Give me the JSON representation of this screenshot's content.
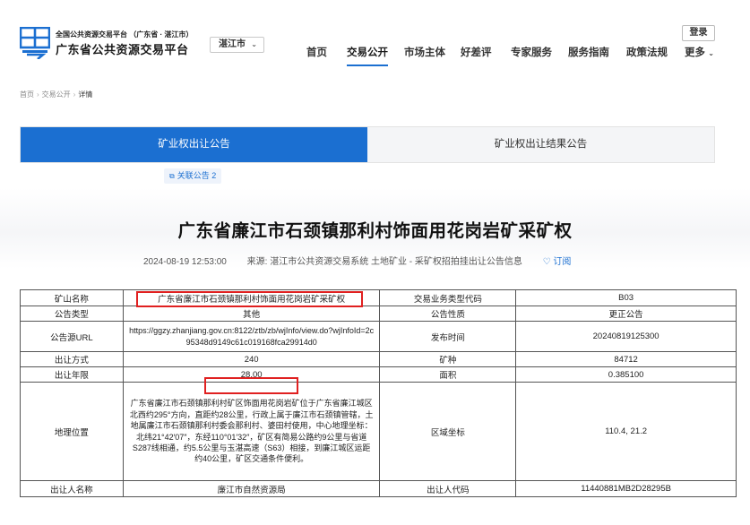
{
  "header": {
    "logo_subtitle": "全国公共资源交易平台 （广东省 · 湛江市）",
    "logo_title": "广东省公共资源交易平台",
    "city_select": "湛江市",
    "login_label": "登录",
    "nav": [
      "首页",
      "交易公开",
      "市场主体",
      "好差评",
      "专家服务",
      "服务指南",
      "政策法规",
      "更多"
    ],
    "nav_active": "交易公开"
  },
  "breadcrumb": [
    "首页",
    "交易公开",
    "详情"
  ],
  "tabs": {
    "active": "矿业权出让公告",
    "inactive": "矿业权出让结果公告"
  },
  "related_label": "关联公告 2",
  "announcement": {
    "title": "广东省廉江市石颈镇那利村饰面用花岗岩矿采矿权",
    "date": "2024-08-19 12:53:00",
    "source_label": "来源:",
    "source": "湛江市公共资源交易系统 土地矿业 - 采矿权招拍挂出让公告信息",
    "subscribe": "订阅"
  },
  "table": {
    "rows": [
      {
        "k1": "矿山名称",
        "v1": "广东省廉江市石颈镇那利村饰面用花岗岩矿采矿权",
        "k2": "交易业务类型代码",
        "v2": "B03"
      },
      {
        "k1": "公告类型",
        "v1": "其他",
        "k2": "公告性质",
        "v2": "更正公告"
      },
      {
        "k1": "公告源URL",
        "v1": "https://ggzy.zhanjiang.gov.cn:8122/ztb/zb/wjInfo/view.do?wjInfoId=2c95348d9149c61c019168fca29914d0",
        "k2": "发布时间",
        "v2": "20240819125300"
      },
      {
        "k1": "出让方式",
        "v1": "240",
        "k2": "矿种",
        "v2": "84712"
      },
      {
        "k1": "出让年限",
        "v1": "28.00",
        "k2": "面积",
        "v2": "0.385100"
      },
      {
        "k1": "地理位置",
        "v1": "广东省廉江市石颈镇那利村矿区饰面用花岗岩矿位于广东省廉江城区北西约295°方向，直距约28公里，行政上属于廉江市石颈镇管辖，土地属廉江市石颈镇那利村委会那利村、婆田村使用，中心地理坐标：北纬21°42′07″，东经110°01′32″，矿区有简易公路约9公里与省道S287线相通，约5.5公里与玉湛高速（S63）相接，到廉江城区运距约40公里，矿区交通条件便利。",
        "k2": "区域坐标",
        "v2": "110.4, 21.2"
      },
      {
        "k1": "出让人名称",
        "v1": "廉江市自然资源局",
        "k2": "出让人代码",
        "v2": "11440881MB2D28295B"
      }
    ]
  }
}
